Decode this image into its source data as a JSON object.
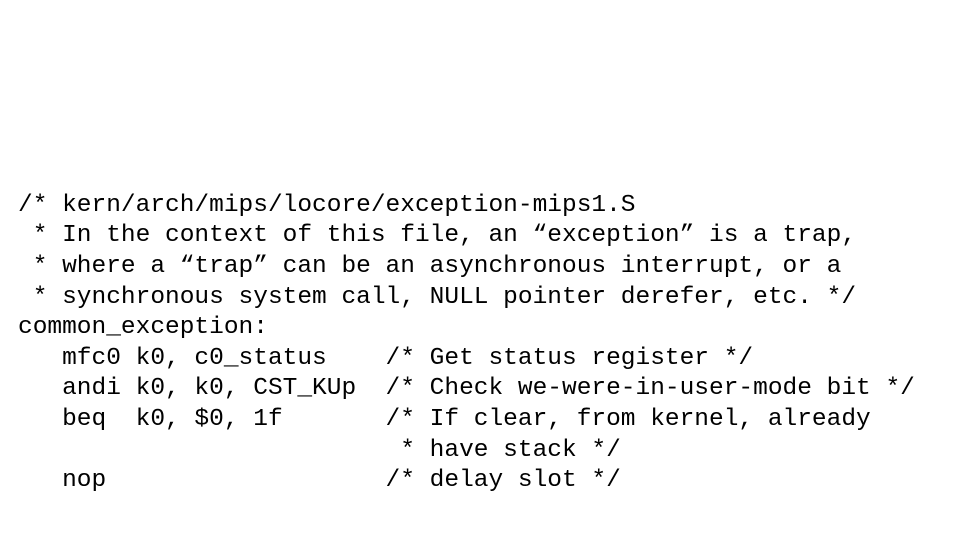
{
  "lines": [
    "/* kern/arch/mips/locore/exception-mips1.S",
    " * In the context of this file, an “exception” is a trap,",
    " * where a “trap” can be an asynchronous interrupt, or a",
    " * synchronous system call, NULL pointer derefer, etc. */",
    "common_exception:",
    "   mfc0 k0, c0_status    /* Get status register */",
    "   andi k0, k0, CST_KUp  /* Check we-were-in-user-mode bit */",
    "   beq  k0, $0, 1f       /* If clear, from kernel, already",
    "                          * have stack */",
    "   nop                   /* delay slot */"
  ]
}
